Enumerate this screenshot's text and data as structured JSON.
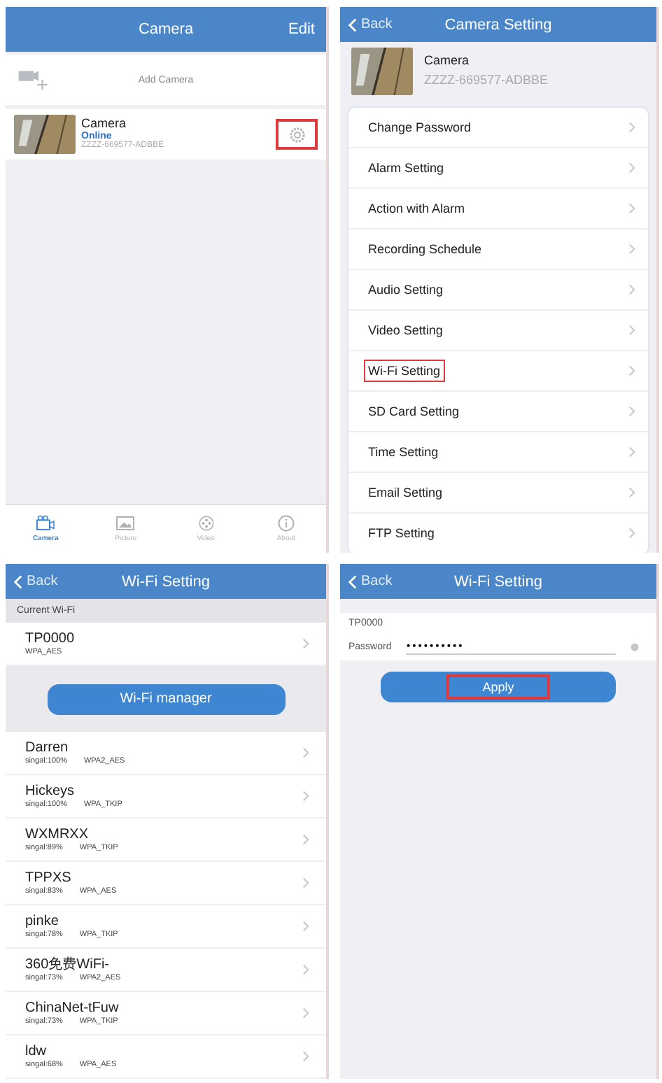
{
  "camera_list": {
    "title": "Camera",
    "edit": "Edit",
    "add_camera": "Add Camera",
    "cameras": [
      {
        "name": "Camera",
        "status": "Online",
        "uid": "ZZZZ-669577-ADBBE",
        "settings_highlighted": true
      }
    ],
    "tabs": [
      {
        "label": "Camera",
        "selected": true
      },
      {
        "label": "Picture",
        "selected": false
      },
      {
        "label": "Video",
        "selected": false
      },
      {
        "label": "About",
        "selected": false
      }
    ]
  },
  "camera_setting": {
    "back": "Back",
    "title": "Camera Setting",
    "camera": {
      "name": "Camera",
      "uid": "ZZZZ-669577-ADBBE"
    },
    "items": [
      {
        "label": "Change Password",
        "highlighted": false
      },
      {
        "label": "Alarm Setting",
        "highlighted": false
      },
      {
        "label": "Action with Alarm",
        "highlighted": false
      },
      {
        "label": "Recording Schedule",
        "highlighted": false
      },
      {
        "label": "Audio Setting",
        "highlighted": false
      },
      {
        "label": "Video Setting",
        "highlighted": false
      },
      {
        "label": "Wi-Fi Setting",
        "highlighted": true
      },
      {
        "label": "SD Card Setting",
        "highlighted": false
      },
      {
        "label": "Time Setting",
        "highlighted": false
      },
      {
        "label": "Email Setting",
        "highlighted": false
      },
      {
        "label": "FTP Setting",
        "highlighted": false
      }
    ]
  },
  "wifi_list": {
    "back": "Back",
    "title": "Wi-Fi Setting",
    "section": "Current Wi-Fi",
    "current": {
      "ssid": "TP0000",
      "security": "WPA_AES"
    },
    "manager_button": "Wi-Fi manager",
    "networks": [
      {
        "ssid": "Darren",
        "signal": "singal:100%",
        "security": "WPA2_AES"
      },
      {
        "ssid": "Hickeys",
        "signal": "singal:100%",
        "security": "WPA_TKIP"
      },
      {
        "ssid": "WXMRXX",
        "signal": "singal:89%",
        "security": "WPA_TKIP"
      },
      {
        "ssid": "TPPXS",
        "signal": "singal:83%",
        "security": "WPA_AES"
      },
      {
        "ssid": "pinke",
        "signal": "singal:78%",
        "security": "WPA_TKIP"
      },
      {
        "ssid": "360免费WiFi-",
        "signal": "singal:73%",
        "security": "WPA2_AES"
      },
      {
        "ssid": "ChinaNet-tFuw",
        "signal": "singal:73%",
        "security": "WPA_TKIP"
      },
      {
        "ssid": "ldw",
        "signal": "singal:68%",
        "security": "WPA_AES"
      }
    ]
  },
  "wifi_password": {
    "back": "Back",
    "title": "Wi-Fi Setting",
    "ssid": "TP0000",
    "password_label": "Password",
    "password_value": "••••••••••",
    "apply": "Apply",
    "apply_highlighted": true
  }
}
